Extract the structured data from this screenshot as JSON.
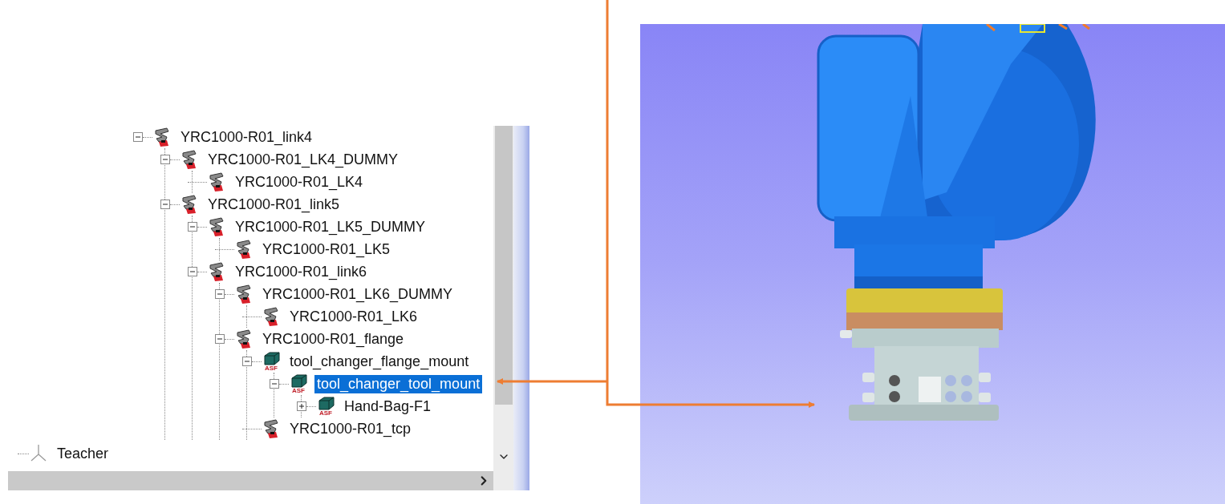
{
  "tree": {
    "nodes": [
      {
        "label": "YRC1000-R01_link4",
        "kind": "frame",
        "expanded": true,
        "selected": false,
        "children": [
          {
            "label": "YRC1000-R01_LK4_DUMMY",
            "kind": "frame",
            "expanded": true,
            "selected": false,
            "children": [
              {
                "label": "YRC1000-R01_LK4",
                "kind": "frame",
                "selected": false
              }
            ]
          },
          {
            "label": "YRC1000-R01_link5",
            "kind": "frame",
            "expanded": true,
            "selected": false,
            "children": [
              {
                "label": "YRC1000-R01_LK5_DUMMY",
                "kind": "frame",
                "expanded": true,
                "selected": false,
                "children": [
                  {
                    "label": "YRC1000-R01_LK5",
                    "kind": "frame",
                    "selected": false
                  }
                ]
              },
              {
                "label": "YRC1000-R01_link6",
                "kind": "frame",
                "expanded": true,
                "selected": false,
                "children": [
                  {
                    "label": "YRC1000-R01_LK6_DUMMY",
                    "kind": "frame",
                    "expanded": true,
                    "selected": false,
                    "children": [
                      {
                        "label": "YRC1000-R01_LK6",
                        "kind": "frame",
                        "selected": false
                      }
                    ]
                  },
                  {
                    "label": "YRC1000-R01_flange",
                    "kind": "frame",
                    "expanded": true,
                    "selected": false,
                    "children": [
                      {
                        "label": "tool_changer_flange_mount",
                        "kind": "part",
                        "icon_label": "ASF",
                        "expanded": true,
                        "selected": false,
                        "children": [
                          {
                            "label": "tool_changer_tool_mount",
                            "kind": "part",
                            "icon_label": "ASF",
                            "expanded": true,
                            "selected": true,
                            "children": [
                              {
                                "label": "Hand-Bag-F1",
                                "kind": "part",
                                "icon_label": "ASF",
                                "expanded": false,
                                "selected": false
                              }
                            ]
                          }
                        ]
                      },
                      {
                        "label": "YRC1000-R01_tcp",
                        "kind": "frame",
                        "selected": false
                      }
                    ]
                  }
                ]
              }
            ]
          }
        ]
      }
    ],
    "root_items": [
      {
        "label": "Teacher",
        "kind": "teacher"
      }
    ]
  }
}
